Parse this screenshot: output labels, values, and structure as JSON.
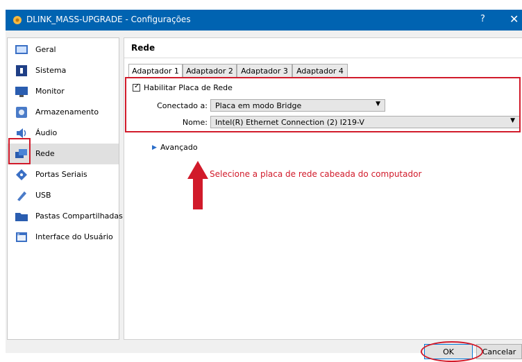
{
  "window": {
    "title": "DLINK_MASS-UPGRADE - Configurações",
    "help_glyph": "?",
    "close_glyph": "✕"
  },
  "sidebar": {
    "items": [
      {
        "label": "Geral",
        "icon": "general-icon"
      },
      {
        "label": "Sistema",
        "icon": "system-icon"
      },
      {
        "label": "Monitor",
        "icon": "monitor-icon"
      },
      {
        "label": "Armazenamento",
        "icon": "storage-icon"
      },
      {
        "label": "Áudio",
        "icon": "audio-icon"
      },
      {
        "label": "Rede",
        "icon": "network-icon",
        "selected": true
      },
      {
        "label": "Portas Seriais",
        "icon": "serial-ports-icon"
      },
      {
        "label": "USB",
        "icon": "usb-icon"
      },
      {
        "label": "Pastas Compartilhadas",
        "icon": "shared-folders-icon"
      },
      {
        "label": "Interface do Usuário",
        "icon": "user-interface-icon"
      }
    ]
  },
  "main": {
    "title": "Rede",
    "tabs": [
      {
        "label": "Adaptador 1",
        "active": true
      },
      {
        "label": "Adaptador 2"
      },
      {
        "label": "Adaptador 3"
      },
      {
        "label": "Adaptador 4"
      }
    ],
    "enable_checkbox": {
      "label": "Habilitar Placa de Rede",
      "checked": true
    },
    "attached_to": {
      "label": "Conectado a:",
      "value": "Placa em modo Bridge"
    },
    "name": {
      "label": "Nome:",
      "value": "Intel(R) Ethernet Connection (2) I219-V"
    },
    "advanced": {
      "label": "Avançado"
    }
  },
  "annotation": {
    "text": "Selecione a placa de rede cabeada do computador",
    "color": "#d11a2a"
  },
  "buttons": {
    "ok": "OK",
    "cancel": "Cancelar"
  },
  "colors": {
    "titlebar": "#0063b1",
    "annotation": "#d11a2a"
  }
}
